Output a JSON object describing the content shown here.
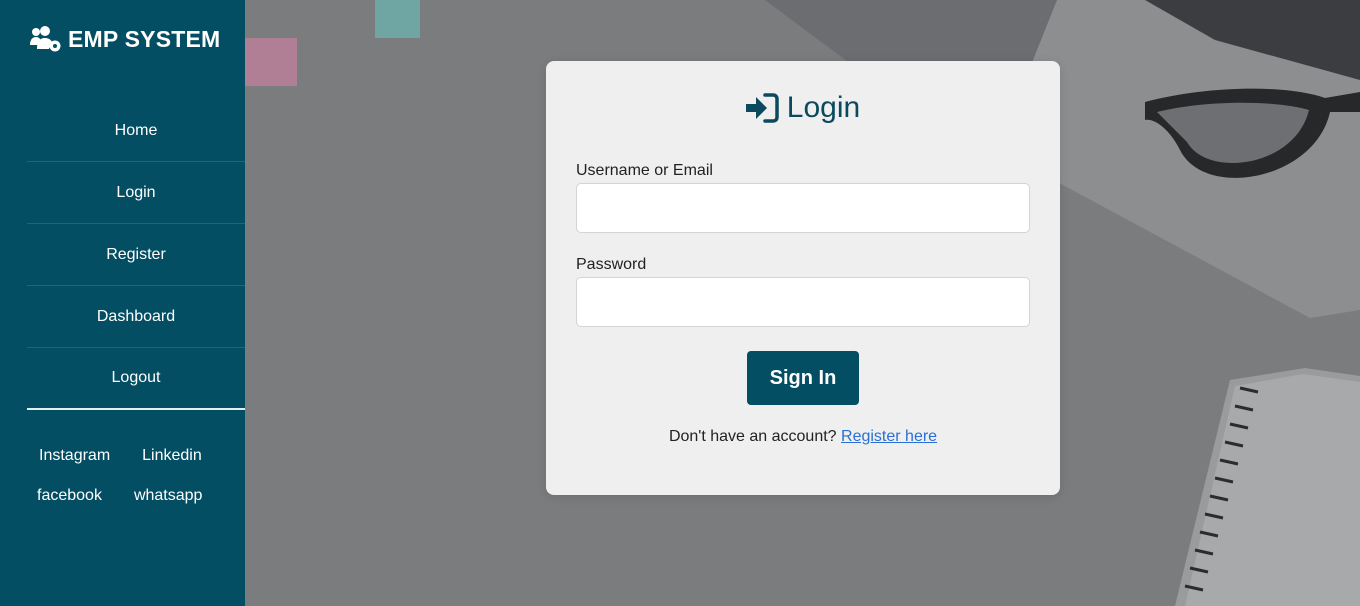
{
  "brand": {
    "name": "EMP SYSTEM",
    "icon": "users-cog-icon"
  },
  "nav": {
    "items": [
      {
        "label": "Home"
      },
      {
        "label": "Login"
      },
      {
        "label": "Register"
      },
      {
        "label": "Dashboard"
      },
      {
        "label": "Logout"
      }
    ]
  },
  "social": {
    "instagram": "Instagram",
    "linkedin": "Linkedin",
    "facebook": "facebook",
    "whatsapp": "whatsapp"
  },
  "login": {
    "title": "Login",
    "title_icon": "sign-in-icon",
    "username_label": "Username or Email",
    "username_value": "",
    "password_label": "Password",
    "password_value": "",
    "submit_label": "Sign In",
    "register_prompt": "Don't have an account?",
    "register_link": "Register here"
  },
  "colors": {
    "sidebar": "#044e63",
    "accent": "#0b4a5e",
    "card": "#efefef",
    "link": "#2a6fd6"
  }
}
